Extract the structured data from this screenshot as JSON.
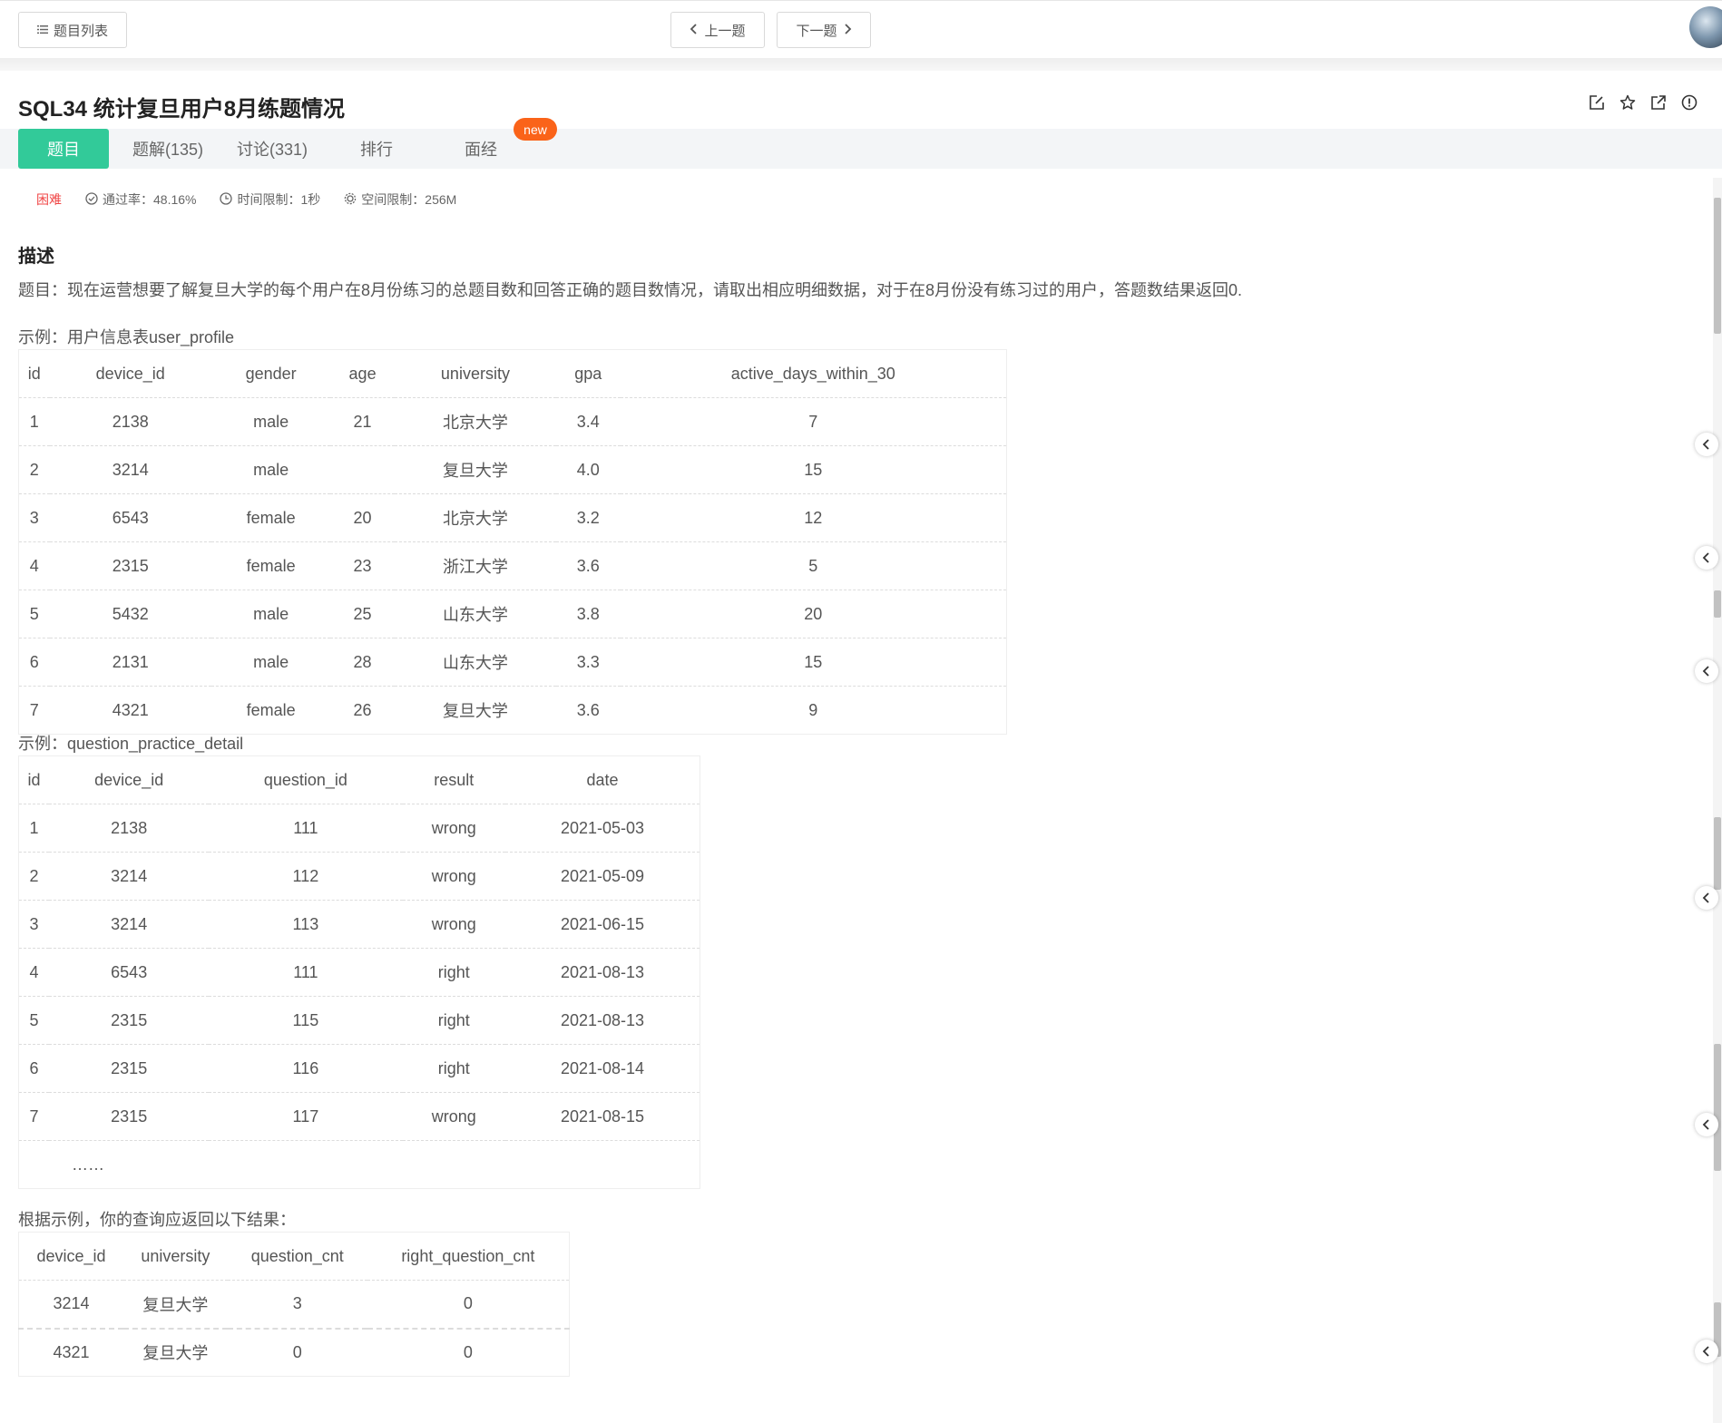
{
  "toolbar": {
    "list_label": "题目列表",
    "prev_label": "上一题",
    "next_label": "下一题"
  },
  "problem": {
    "title": "SQL34  统计复旦用户8月练题情况"
  },
  "tabs": [
    {
      "label": "题目"
    },
    {
      "label": "题解(135)"
    },
    {
      "label": "讨论(331)"
    },
    {
      "label": "排行"
    },
    {
      "label": "面经"
    }
  ],
  "new_badge": "new",
  "meta": {
    "difficulty": "困难",
    "pass_rate": "通过率：48.16%",
    "time_limit": "时间限制：1秒",
    "space_limit": "空间限制：256M"
  },
  "description": {
    "heading": "描述",
    "text": "题目：现在运营想要了解复旦大学的每个用户在8月份练习的总题目数和回答正确的题目数情况，请取出相应明细数据，对于在8月份没有练习过的用户，答题数结果返回0."
  },
  "table1": {
    "caption": "示例：用户信息表user_profile",
    "headers": [
      "id",
      "device_id",
      "gender",
      "age",
      "university",
      "gpa",
      "active_days_within_30"
    ],
    "rows": [
      [
        "1",
        "2138",
        "male",
        "21",
        "北京大学",
        "3.4",
        "7"
      ],
      [
        "2",
        "3214",
        "male",
        "",
        "复旦大学",
        "4.0",
        "15"
      ],
      [
        "3",
        "6543",
        "female",
        "20",
        "北京大学",
        "3.2",
        "12"
      ],
      [
        "4",
        "2315",
        "female",
        "23",
        "浙江大学",
        "3.6",
        "5"
      ],
      [
        "5",
        "5432",
        "male",
        "25",
        "山东大学",
        "3.8",
        "20"
      ],
      [
        "6",
        "2131",
        "male",
        "28",
        "山东大学",
        "3.3",
        "15"
      ],
      [
        "7",
        "4321",
        "female",
        "26",
        "复旦大学",
        "3.6",
        "9"
      ]
    ]
  },
  "table2": {
    "caption": "示例：question_practice_detail",
    "headers": [
      "id",
      "device_id",
      "question_id",
      "result",
      "date"
    ],
    "rows": [
      [
        "1",
        "2138",
        "111",
        "wrong",
        "2021-05-03"
      ],
      [
        "2",
        "3214",
        "112",
        "wrong",
        "2021-05-09"
      ],
      [
        "3",
        "3214",
        "113",
        "wrong",
        "2021-06-15"
      ],
      [
        "4",
        "6543",
        "111",
        "right",
        "2021-08-13"
      ],
      [
        "5",
        "2315",
        "115",
        "right",
        "2021-08-13"
      ],
      [
        "6",
        "2315",
        "116",
        "right",
        "2021-08-14"
      ],
      [
        "7",
        "2315",
        "117",
        "wrong",
        "2021-08-15"
      ]
    ],
    "ellipsis": "……"
  },
  "table3": {
    "caption": "根据示例，你的查询应返回以下结果：",
    "headers": [
      "device_id",
      "university",
      "question_cnt",
      "right_question_cnt"
    ],
    "rows": [
      [
        "3214",
        "复旦大学",
        "3",
        "0"
      ],
      [
        "4321",
        "复旦大学",
        "0",
        "0"
      ]
    ]
  },
  "icons": {
    "list": "list-icon",
    "prev": "chevron-left-icon",
    "next": "chevron-right-icon",
    "edit": "edit-icon",
    "star": "star-icon",
    "share": "share-icon",
    "report": "report-icon",
    "pass": "check-circle-icon",
    "time": "clock-icon",
    "space": "gear-icon"
  }
}
